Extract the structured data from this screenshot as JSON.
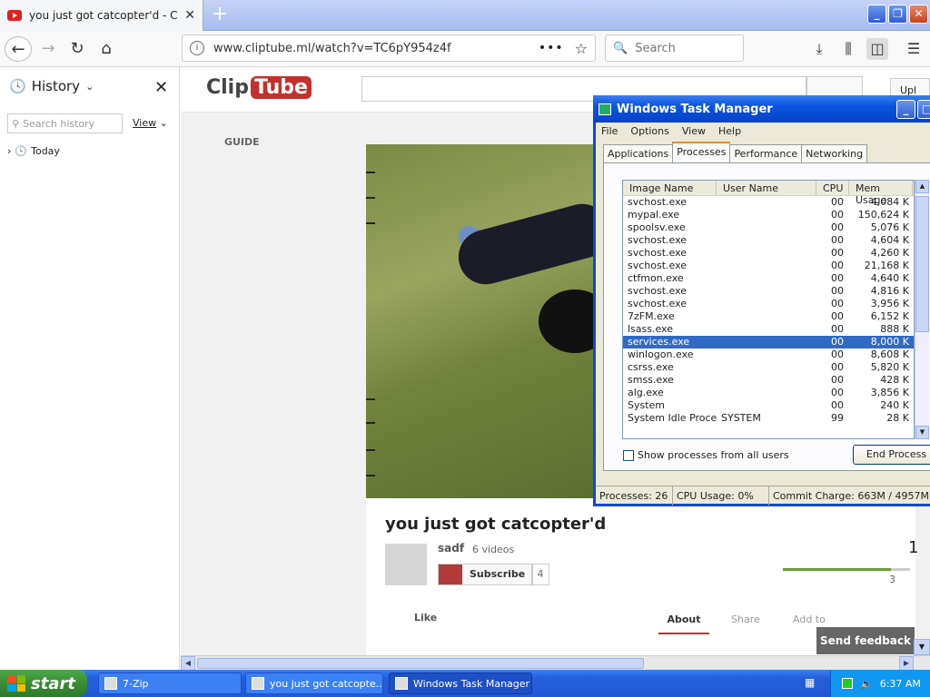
{
  "browser": {
    "tab_title": "you just got catcopter'd - ClipTube",
    "tab_close": "✕",
    "new_tab": "+",
    "url": "www.cliptube.ml/watch?v=TC6pY954z4f",
    "search_placeholder": "Search"
  },
  "sidebar": {
    "title": "History",
    "search_placeholder": "Search history",
    "view_label": "View",
    "close": "✕",
    "items": [
      {
        "label": "Today"
      }
    ]
  },
  "page": {
    "logo_clip": "Clip",
    "logo_tube": "Tube",
    "upload_label": "Upl",
    "guide_label": "GUIDE",
    "video_title": "you just got catcopter'd",
    "channel_name": "sadf",
    "channel_videos": "6 videos",
    "subscribe_label": "Subscribe",
    "subscriber_count": "4",
    "view_count_partial": "1",
    "like_bar_fraction": 0.85,
    "like_count": "3",
    "like_label": "Like",
    "tabs": [
      "About",
      "Share",
      "Add to"
    ],
    "feedback_label": "Send feedback"
  },
  "task_manager": {
    "title": "Windows Task Manager",
    "menu": [
      "File",
      "Options",
      "View",
      "Help"
    ],
    "tabs": [
      "Applications",
      "Processes",
      "Performance",
      "Networking"
    ],
    "active_tab": "Processes",
    "columns": [
      "Image Name",
      "User Name",
      "CPU",
      "Mem Usage"
    ],
    "processes": [
      {
        "name": "svchost.exe",
        "user": "",
        "cpu": "00",
        "mem": "4,084 K"
      },
      {
        "name": "mypal.exe",
        "user": "",
        "cpu": "00",
        "mem": "150,624 K"
      },
      {
        "name": "spoolsv.exe",
        "user": "",
        "cpu": "00",
        "mem": "5,076 K"
      },
      {
        "name": "svchost.exe",
        "user": "",
        "cpu": "00",
        "mem": "4,604 K"
      },
      {
        "name": "svchost.exe",
        "user": "",
        "cpu": "00",
        "mem": "4,260 K"
      },
      {
        "name": "svchost.exe",
        "user": "",
        "cpu": "00",
        "mem": "21,168 K"
      },
      {
        "name": "ctfmon.exe",
        "user": "",
        "cpu": "00",
        "mem": "4,640 K"
      },
      {
        "name": "svchost.exe",
        "user": "",
        "cpu": "00",
        "mem": "4,816 K"
      },
      {
        "name": "svchost.exe",
        "user": "",
        "cpu": "00",
        "mem": "3,956 K"
      },
      {
        "name": "7zFM.exe",
        "user": "",
        "cpu": "00",
        "mem": "6,152 K"
      },
      {
        "name": "lsass.exe",
        "user": "",
        "cpu": "00",
        "mem": "888 K"
      },
      {
        "name": "services.exe",
        "user": "",
        "cpu": "00",
        "mem": "8,000 K",
        "selected": true
      },
      {
        "name": "winlogon.exe",
        "user": "",
        "cpu": "00",
        "mem": "8,608 K"
      },
      {
        "name": "csrss.exe",
        "user": "",
        "cpu": "00",
        "mem": "5,820 K"
      },
      {
        "name": "smss.exe",
        "user": "",
        "cpu": "00",
        "mem": "428 K"
      },
      {
        "name": "alg.exe",
        "user": "",
        "cpu": "00",
        "mem": "3,856 K"
      },
      {
        "name": "System",
        "user": "",
        "cpu": "00",
        "mem": "240 K"
      },
      {
        "name": "System Idle Process",
        "user": "SYSTEM",
        "cpu": "99",
        "mem": "28 K"
      }
    ],
    "show_all_label": "Show processes from all users",
    "end_process_label": "End Process",
    "status": {
      "processes": "Processes: 26",
      "cpu": "CPU Usage: 0%",
      "commit": "Commit Charge: 663M / 4957M"
    }
  },
  "taskbar": {
    "start_label": "start",
    "items": [
      {
        "label": "7-Zip"
      },
      {
        "label": "you just got catcopte..."
      },
      {
        "label": "Windows Task Manager",
        "active": true
      }
    ],
    "clock": "6:37 AM"
  }
}
